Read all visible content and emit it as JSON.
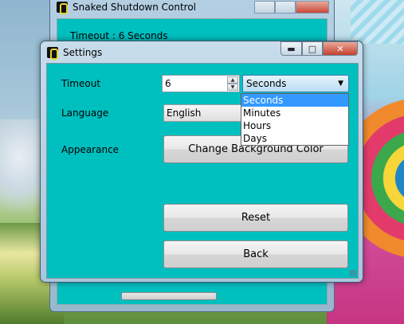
{
  "main_window": {
    "title": "Snaked Shutdown Control",
    "status_text": "Timeout : 6 Seconds"
  },
  "dialog": {
    "title": "Settings",
    "close_glyph": "✕",
    "maximize_glyph": "□",
    "minimize_glyph": "▬",
    "timeout_label": "Timeout",
    "timeout_value": "6",
    "unit_selected": "Seconds",
    "language_label": "Language",
    "language_value": "English",
    "appearance_label": "Appearance",
    "change_bg_button": "Change Background Color",
    "reset_button": "Reset",
    "back_button": "Back",
    "unit_options": [
      "Seconds",
      "Minutes",
      "Hours",
      "Days"
    ]
  },
  "colors": {
    "client_bg": "#00bfbf",
    "selection": "#3399ff"
  },
  "icons": {
    "app": "snake-app-icon",
    "spin_up": "arrow-up-icon",
    "spin_down": "arrow-down-icon",
    "combo": "chevron-down-icon",
    "grip": "resize-grip-icon"
  }
}
